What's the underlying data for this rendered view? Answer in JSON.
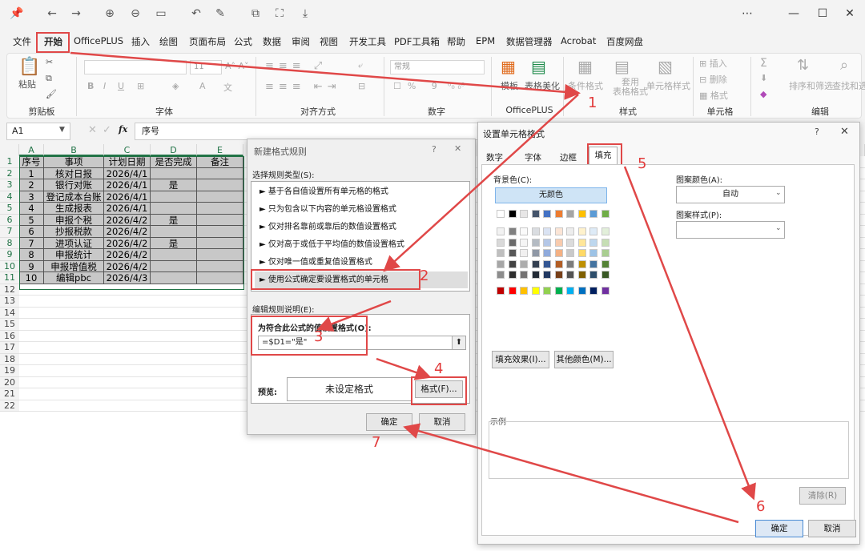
{
  "toolbar_icons": [
    "pin-icon",
    "undo-icon",
    "redo-icon",
    "zoom-in-icon",
    "zoom-out-icon",
    "fit-icon",
    "rotate-icon",
    "edit-icon",
    "copy-icon",
    "crop-icon",
    "save-icon"
  ],
  "menu_tabs": [
    "文件",
    "开始",
    "OfficePLUS",
    "插入",
    "绘图",
    "页面布局",
    "公式",
    "数据",
    "审阅",
    "视图",
    "开发工具",
    "PDF工具箱",
    "帮助",
    "EPM",
    "数据管理器",
    "Acrobat",
    "百度网盘"
  ],
  "ribbon": {
    "paste": "粘贴",
    "clipboard": "剪贴板",
    "font": "字体",
    "font_size": "11",
    "alignment": "对齐方式",
    "number_format": "常规",
    "number": "数字",
    "template": "模板",
    "table_beautify": "表格美化",
    "officeplus": "OfficePLUS",
    "conditional_format": "条件格式",
    "apply_table_format": "套用\n表格格式",
    "cell_style": "单元格样式",
    "style": "样式",
    "insert": "插入",
    "delete": "删除",
    "format": "格式",
    "cells": "单元格",
    "sort_filter": "排序和筛选",
    "find_select": "查找和选",
    "edit": "编辑"
  },
  "formula_bar": {
    "name_box": "A1",
    "fx": "fx",
    "content": "序号"
  },
  "sheet": {
    "columns": [
      "A",
      "B",
      "C",
      "D",
      "E"
    ],
    "rows_count": 22,
    "header": [
      "序号",
      "事项",
      "计划日期",
      "是否完成",
      "备注"
    ],
    "data": [
      [
        "1",
        "核对日报",
        "2026/4/1",
        "",
        ""
      ],
      [
        "2",
        "银行对账",
        "2026/4/1",
        "是",
        ""
      ],
      [
        "3",
        "登记成本台账",
        "2026/4/1",
        "",
        ""
      ],
      [
        "4",
        "生成报表",
        "2026/4/1",
        "",
        ""
      ],
      [
        "5",
        "申报个税",
        "2026/4/2",
        "是",
        ""
      ],
      [
        "6",
        "抄报税款",
        "2026/4/2",
        "",
        ""
      ],
      [
        "7",
        "进项认证",
        "2026/4/2",
        "是",
        ""
      ],
      [
        "8",
        "申报统计",
        "2026/4/2",
        "",
        ""
      ],
      [
        "9",
        "申报增值税",
        "2026/4/2",
        "",
        ""
      ],
      [
        "10",
        "编辑pbc",
        "2026/4/3",
        "",
        ""
      ]
    ]
  },
  "new_rule_dialog": {
    "title": "新建格式规则",
    "select_type": "选择规则类型(S):",
    "rules": [
      "► 基于各自值设置所有单元格的格式",
      "► 只为包含以下内容的单元格设置格式",
      "► 仅对排名靠前或靠后的数值设置格式",
      "► 仅对高于或低于平均值的数值设置格式",
      "► 仅对唯一值或重复值设置格式",
      "► 使用公式确定要设置格式的单元格"
    ],
    "edit_desc": "编辑规则说明(E):",
    "formula_label": "为符合此公式的值设置格式(O):",
    "formula": "=$D1=\"是\"",
    "preview_label": "预览:",
    "preview_text": "未设定格式",
    "format_btn": "格式(F)...",
    "ok": "确定",
    "cancel": "取消"
  },
  "format_cells_dialog": {
    "title": "设置单元格格式",
    "tabs": [
      "数字",
      "字体",
      "边框",
      "填充"
    ],
    "bg_color": "背景色(C):",
    "no_color": "无颜色",
    "pattern_color": "图案颜色(A):",
    "pattern_color_value": "自动",
    "pattern_style": "图案样式(P):",
    "fill_effects": "填充效果(I)...",
    "more_colors": "其他颜色(M)...",
    "sample": "示例",
    "clear": "清除(R)",
    "ok": "确定",
    "cancel": "取消"
  },
  "annotations": [
    "1",
    "2",
    "3",
    "4",
    "5",
    "6",
    "7"
  ],
  "colors": {
    "annotation_red": "#e04848",
    "std_row": [
      "#c00000",
      "#ff0000",
      "#ffc000",
      "#ffff00",
      "#92d050",
      "#00b050",
      "#00b0f0",
      "#0070c0",
      "#002060",
      "#7030a0"
    ],
    "theme_row": [
      "#ffffff",
      "#000000",
      "#e7e6e6",
      "#44546a",
      "#4472c4",
      "#ed7d31",
      "#a5a5a5",
      "#ffc000",
      "#5b9bd5",
      "#70ad47"
    ]
  }
}
